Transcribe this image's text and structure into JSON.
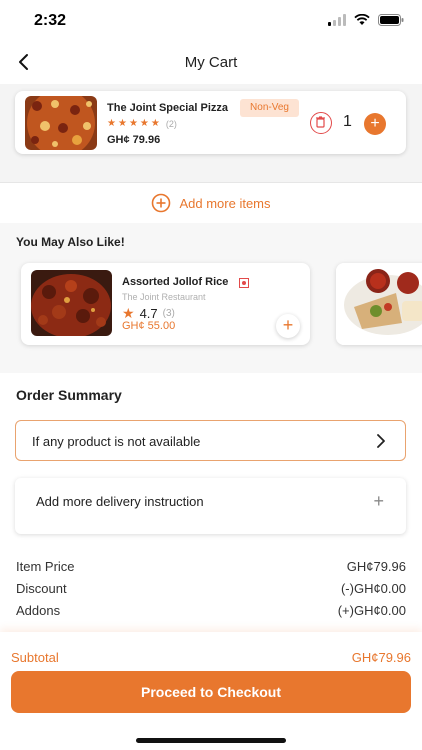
{
  "status_bar": {
    "time": "2:32"
  },
  "header": {
    "title": "My Cart"
  },
  "cart": {
    "items": [
      {
        "name": "The Joint Special Pizza",
        "badge": "Non-Veg",
        "rating_stars": 5,
        "review_count": "(2)",
        "price": "GH¢ 79.96",
        "quantity": "1"
      }
    ],
    "add_more_label": "Add more items"
  },
  "recommendations": {
    "title": "You May Also Like!",
    "items": [
      {
        "name": "Assorted Jollof Rice",
        "restaurant": "The Joint Restaurant",
        "rating": "4.7",
        "rating_count": "(3)",
        "price": "GH¢ 55.00"
      }
    ]
  },
  "order_summary": {
    "title": "Order Summary",
    "unavailable_label": "If any product is not available",
    "delivery_instruction_label": "Add more delivery instruction",
    "rows": [
      {
        "label": "Item Price",
        "value": "GH¢79.96"
      },
      {
        "label": "Discount",
        "value": "(-)GH¢0.00"
      },
      {
        "label": "Addons",
        "value": "(+)GH¢0.00"
      }
    ]
  },
  "footer": {
    "subtotal_label": "Subtotal",
    "subtotal_value": "GH¢79.96",
    "checkout_label": "Proceed to Checkout"
  },
  "colors": {
    "accent": "#e8772e",
    "danger": "#e24a4a"
  },
  "icons": [
    "back-arrow-icon",
    "signal-icon",
    "wifi-icon",
    "battery-icon",
    "trash-icon",
    "plus-icon",
    "add-circle-icon",
    "star-icon",
    "non-veg-icon",
    "chevron-right-icon"
  ]
}
